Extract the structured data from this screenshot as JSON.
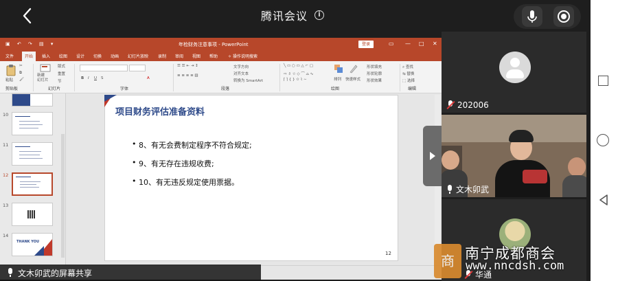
{
  "app": {
    "title": "腾讯会议",
    "share_label": "文木卯武的屏幕共享"
  },
  "ppt": {
    "doc_title": "年检财务注意事项  -  PowerPoint",
    "login": "登录",
    "tabs": [
      "文件",
      "开始",
      "插入",
      "绘图",
      "设计",
      "切换",
      "动画",
      "幻灯片放映",
      "录制",
      "审阅",
      "视图",
      "帮助",
      "操作说明搜索"
    ],
    "active_tab": "开始",
    "groups": {
      "clipboard": "剪贴板",
      "paste": "粘贴",
      "slides": "幻灯片",
      "new_slide": "新建\n幻灯片",
      "layout": "版式",
      "reset": "重置",
      "section": "节",
      "font": "字体",
      "paragraph": "段落",
      "text_direction": "文字方向",
      "align_text": "对齐文本",
      "smartart": "转换为 SmartArt",
      "drawing": "绘图",
      "arrange": "排列",
      "quick_styles": "快速样式",
      "shape_fill": "形状填充",
      "shape_outline": "形状轮廓",
      "shape_effects": "形状效果",
      "editing": "编辑",
      "find": "查找",
      "replace": "替换",
      "select": "选择"
    },
    "thumbnails": [
      {
        "num": "10"
      },
      {
        "num": "11"
      },
      {
        "num": "12"
      },
      {
        "num": "13"
      },
      {
        "num": "14",
        "text": "THANK YOU"
      }
    ],
    "slide": {
      "heading": "项目财务评估准备资料",
      "bullets": [
        "8、有无会费制定程序不符合规定;",
        "9、有无存在违规收费;",
        "10、有无违反规定使用票据。"
      ],
      "page_number": "12"
    }
  },
  "participants": [
    {
      "name": "202006",
      "muted": true
    },
    {
      "name": "文木卯武",
      "muted": false
    },
    {
      "name": "华通",
      "muted": true
    }
  ],
  "watermark": {
    "name": "南宁成都商会",
    "url": "www.nncdsh.com",
    "logo_char": "商"
  },
  "colors": {
    "ppt_accent": "#b7472a",
    "heading_blue": "#2e4a8a",
    "mute_red": "#e23b3b"
  }
}
